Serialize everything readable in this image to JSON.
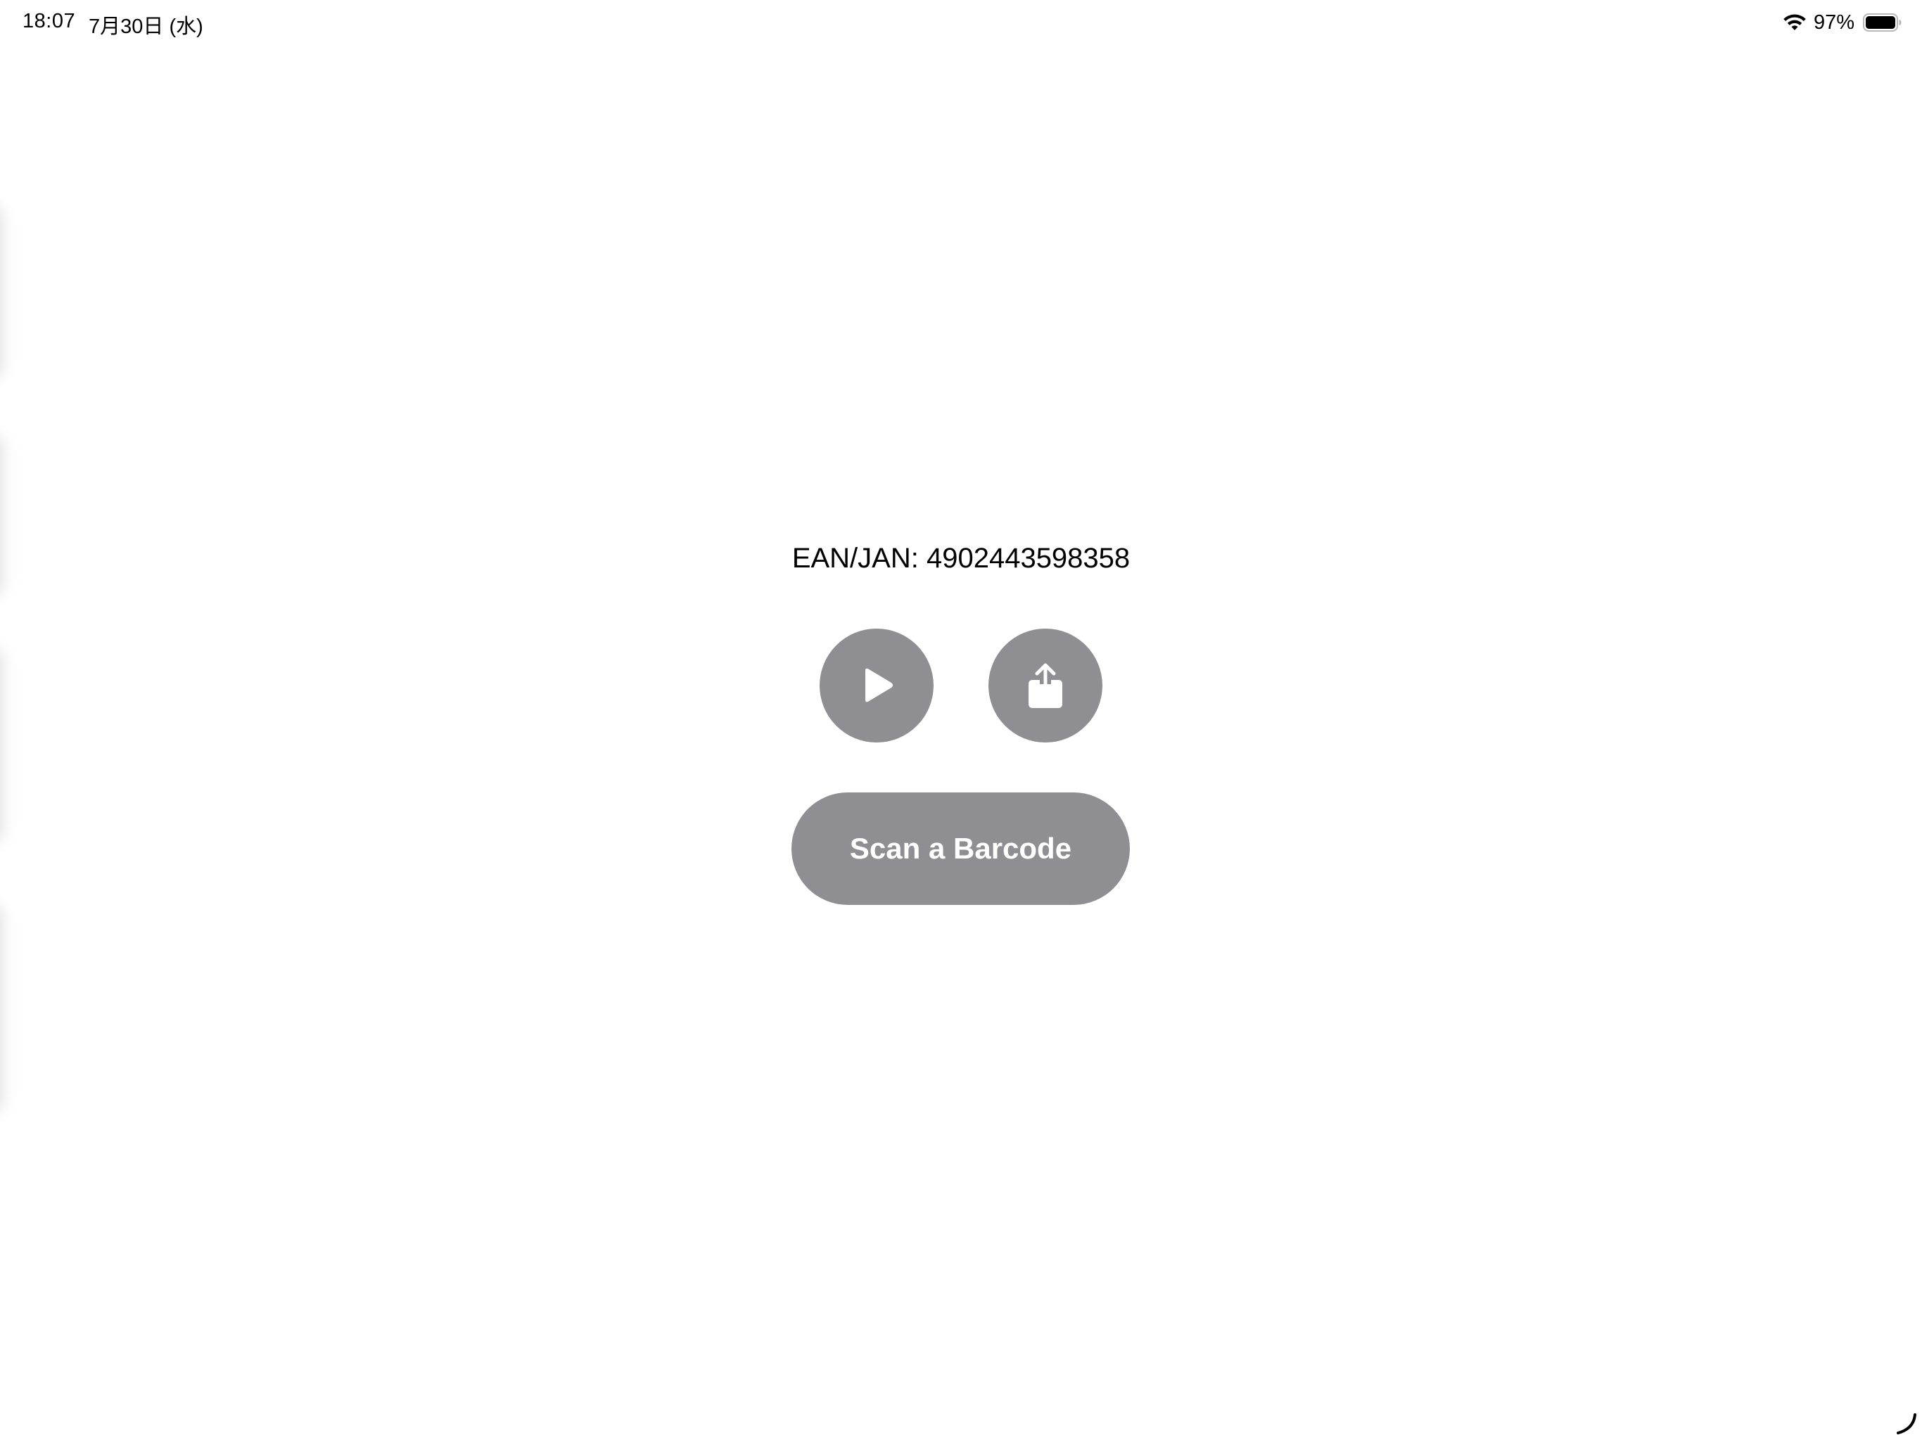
{
  "status_bar": {
    "time": "18:07",
    "date": "7月30日 (水)",
    "battery_percent": "97%",
    "battery_level": 0.97,
    "icons": [
      "wifi-icon",
      "battery-icon"
    ]
  },
  "main": {
    "barcode_text": "EAN/JAN: 4902443598358",
    "play_icon": "play-icon",
    "share_icon": "share-icon",
    "scan_button_label": "Scan a Barcode"
  },
  "colors": {
    "button_gray": "#8e8e93",
    "background": "#ffffff",
    "text": "#000000"
  }
}
